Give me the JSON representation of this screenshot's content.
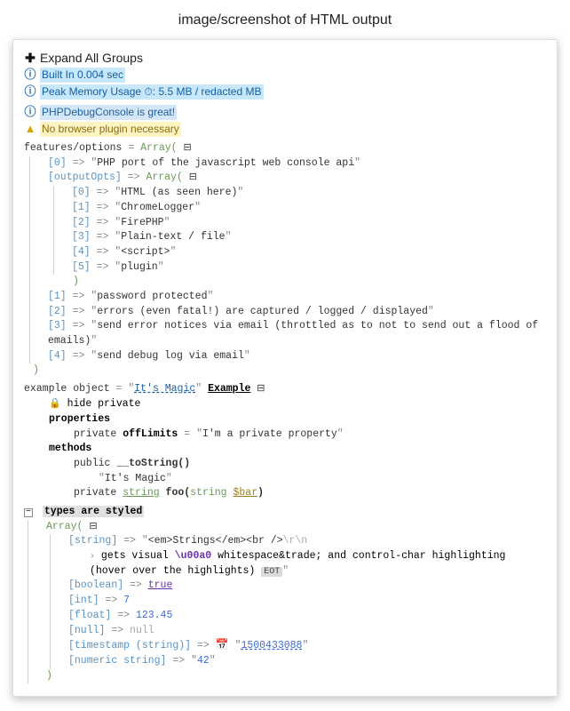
{
  "heading": "image/screenshot of HTML output",
  "expand_all": "Expand All Groups",
  "built_in": "Built In 0.004 sec",
  "peak_mem_label": "Peak Memory Usage",
  "peak_mem_value": "5.5 MB / redacted MB",
  "clock_glyph": "⏱",
  "info_line": "PHPDebugConsole is great!",
  "warn_line": "No browser plugin necessary",
  "features": {
    "varname": "features/options",
    "type": "Array(",
    "items": [
      {
        "k": "0",
        "v": "PHP port of the javascript web console api"
      }
    ],
    "outputOpts": {
      "key": "outputOpts",
      "type": "Array(",
      "items": [
        {
          "k": "0",
          "v": "HTML (as seen here)"
        },
        {
          "k": "1",
          "v": "ChromeLogger"
        },
        {
          "k": "2",
          "v": "FirePHP"
        },
        {
          "k": "3",
          "v": "Plain-text / file"
        },
        {
          "k": "4",
          "v": "<script>"
        },
        {
          "k": "5",
          "v": "plugin"
        }
      ]
    },
    "tail": [
      {
        "k": "1",
        "v": "password protected"
      },
      {
        "k": "2",
        "v": "errors (even fatal!) are captured / logged / displayed"
      },
      {
        "k": "3",
        "v": "send error notices via email (throttled as to not to send out a flood of emails)"
      },
      {
        "k": "4",
        "v": "send debug log via email"
      }
    ]
  },
  "example": {
    "varname": "example object",
    "magic": "It's Magic",
    "classname": "Example",
    "hide_private": "hide private",
    "properties_label": "properties",
    "prop_vis": "private",
    "prop_name": "offLimits",
    "prop_val": "I'm a private property",
    "methods_label": "methods",
    "m1_vis": "public",
    "m1_name": "__toString()",
    "m1_ret": "It's Magic",
    "m2_vis": "private",
    "m2_ret": "string",
    "m2_name": "foo",
    "m2_arg_type": "string",
    "m2_arg_name": "$bar"
  },
  "types": {
    "title": "types are styled",
    "type": "Array(",
    "string_key": "string",
    "string_val_html": "<em>Strings</em><br />",
    "string_escape": "\\r\\n",
    "string_line2_pre": "gets visual ",
    "string_u": "\\u00a0",
    "string_line2_mid": " whitespace&trade; and control-char highlighting (hover over the highlights)",
    "eot": "EOT",
    "boolean_key": "boolean",
    "boolean_val": "true",
    "int_key": "int",
    "int_val": "7",
    "float_key": "float",
    "float_val": "123.45",
    "null_key": "null",
    "null_val": "null",
    "ts_key": "timestamp (string)",
    "ts_val": "1500433088",
    "numstr_key": "numeric string",
    "numstr_val": "42"
  }
}
